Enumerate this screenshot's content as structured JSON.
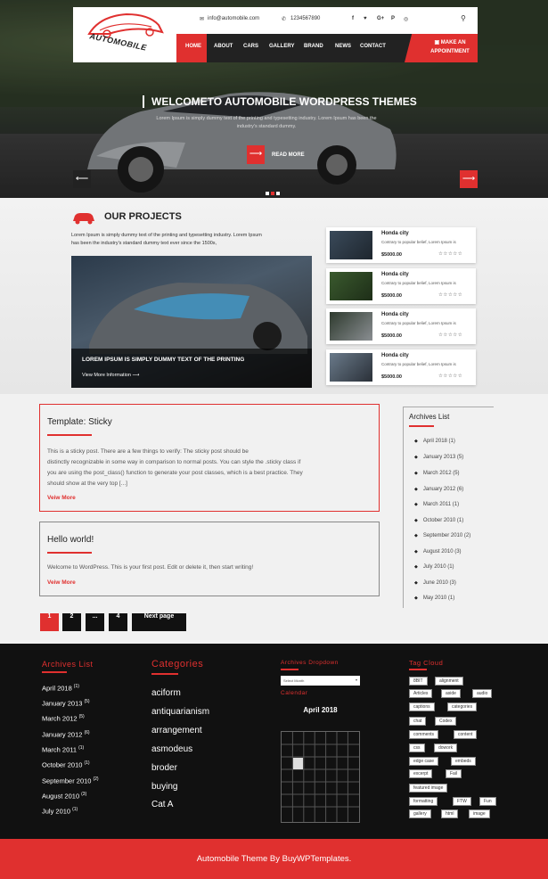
{
  "header": {
    "logo_text": "AUTOMOBILE",
    "email": "info@automobile.com",
    "phone": "1234567890",
    "social_icons": [
      "facebook-icon",
      "twitter-icon",
      "google-plus-icon",
      "pinterest-icon",
      "instagram-icon"
    ],
    "nav": [
      "HOME",
      "ABOUT",
      "CARS",
      "GALLERY",
      "BRAND",
      "NEWS",
      "CONTACT"
    ],
    "appointment": [
      "MAKE AN",
      "APPOINTMENT"
    ]
  },
  "slider": {
    "title": "WELCOMETO AUTOMOBILE WORDPRESS THEMES",
    "desc": "Lorem Ipsum is simply dummy text of the printing and typesetting industry. Lorem Ipsum has been the industry's standard dummy.",
    "read_more": "READ MORE"
  },
  "projects": {
    "title": "OUR PROJECTS",
    "text": "Lorem Ipsum is simply dummy text of the printing and typesetting industry. Lorem Ipsum has been the industry's standard dummy text ever since the 1500s,",
    "main_caption": "LOREM IPSUM IS SIMPLY DUMMY TEXT OF THE PRINTING",
    "main_link": "View More Information",
    "cards": [
      {
        "name": "Honda city",
        "desc": "Contrary to popular belief, Lorem Ipsum is",
        "price": "$5000.00",
        "stars": "☆☆☆☆☆"
      },
      {
        "name": "Honda city",
        "desc": "Contrary to popular belief, Lorem Ipsum is",
        "price": "$5000.00",
        "stars": "☆☆☆☆☆"
      },
      {
        "name": "Honda city",
        "desc": "Contrary to popular belief, Lorem Ipsum is",
        "price": "$5000.00",
        "stars": "☆☆☆☆☆"
      },
      {
        "name": "Honda city",
        "desc": "Contrary to popular belief, Lorem Ipsum is",
        "price": "$5000.00",
        "stars": "☆☆☆☆☆"
      }
    ]
  },
  "posts": [
    {
      "title": "Template: Sticky",
      "text": [
        "This is a sticky post. There are a few things to verify: The sticky post should be",
        "distinctly recognizable in some way in comparison to normal posts. You can style the .sticky class if",
        "you are using the post_class() function to generate your post classes, which is a best practice. They",
        "should show at the very top [...]"
      ],
      "link": "Veiw More"
    },
    {
      "title": "Hello world!",
      "text": [
        "Welcome to WordPress. This is your first post. Edit or delete it, then start writing!"
      ],
      "link": "Veiw More"
    }
  ],
  "sidebar": {
    "title": "Archives List",
    "items": [
      "April 2018 (1)",
      "January 2013 (5)",
      "March 2012 (5)",
      "January 2012 (6)",
      "March 2011 (1)",
      "October 2010 (1)",
      "September 2010 (2)",
      "August 2010 (3)",
      "July 2010 (1)",
      "June 2010 (3)",
      "May 2010 (1)"
    ]
  },
  "pagination": [
    "1",
    "2",
    "...",
    "4",
    "Next page"
  ],
  "footer": {
    "archives_title": "Archives List",
    "archives": [
      {
        "m": "April 2018",
        "c": "(1)"
      },
      {
        "m": "January 2013",
        "c": "(5)"
      },
      {
        "m": "March 2012",
        "c": "(5)"
      },
      {
        "m": "January 2012",
        "c": "(6)"
      },
      {
        "m": "March 2011",
        "c": "(1)"
      },
      {
        "m": "October 2010",
        "c": "(1)"
      },
      {
        "m": "September 2010",
        "c": "(2)"
      },
      {
        "m": "August 2010",
        "c": "(3)"
      },
      {
        "m": "July 2010",
        "c": "(1)"
      }
    ],
    "categories_title": "Categories",
    "categories": [
      "aciform",
      "antiquarianism",
      "arrangement",
      "asmodeus",
      "broder",
      "buying",
      "Cat A"
    ],
    "dropdown_title": "Archives Dropdown",
    "dropdown_value": "Select Month",
    "calendar_title": "Calendar",
    "calendar_month": "April 2018",
    "tag_title": "Tag Cloud",
    "tags": [
      [
        "8BIT",
        "alignment"
      ],
      [
        "Articles",
        "aside",
        "audio"
      ],
      [
        "captions",
        "categories"
      ],
      [
        "chat",
        "Codex"
      ],
      [
        "comments",
        "content"
      ],
      [
        "css",
        "dowork"
      ],
      [
        "edge case",
        "embeds"
      ],
      [
        "excerpt",
        "Fail"
      ],
      [
        "featured image"
      ],
      [
        "formatting",
        "FTW",
        "Fun"
      ],
      [
        "gallery",
        "html",
        "image"
      ]
    ]
  },
  "bottom": "Automobile Theme By BuyWPTemplates.",
  "colors": {
    "accent": "#e0302f",
    "dark": "#111111"
  }
}
